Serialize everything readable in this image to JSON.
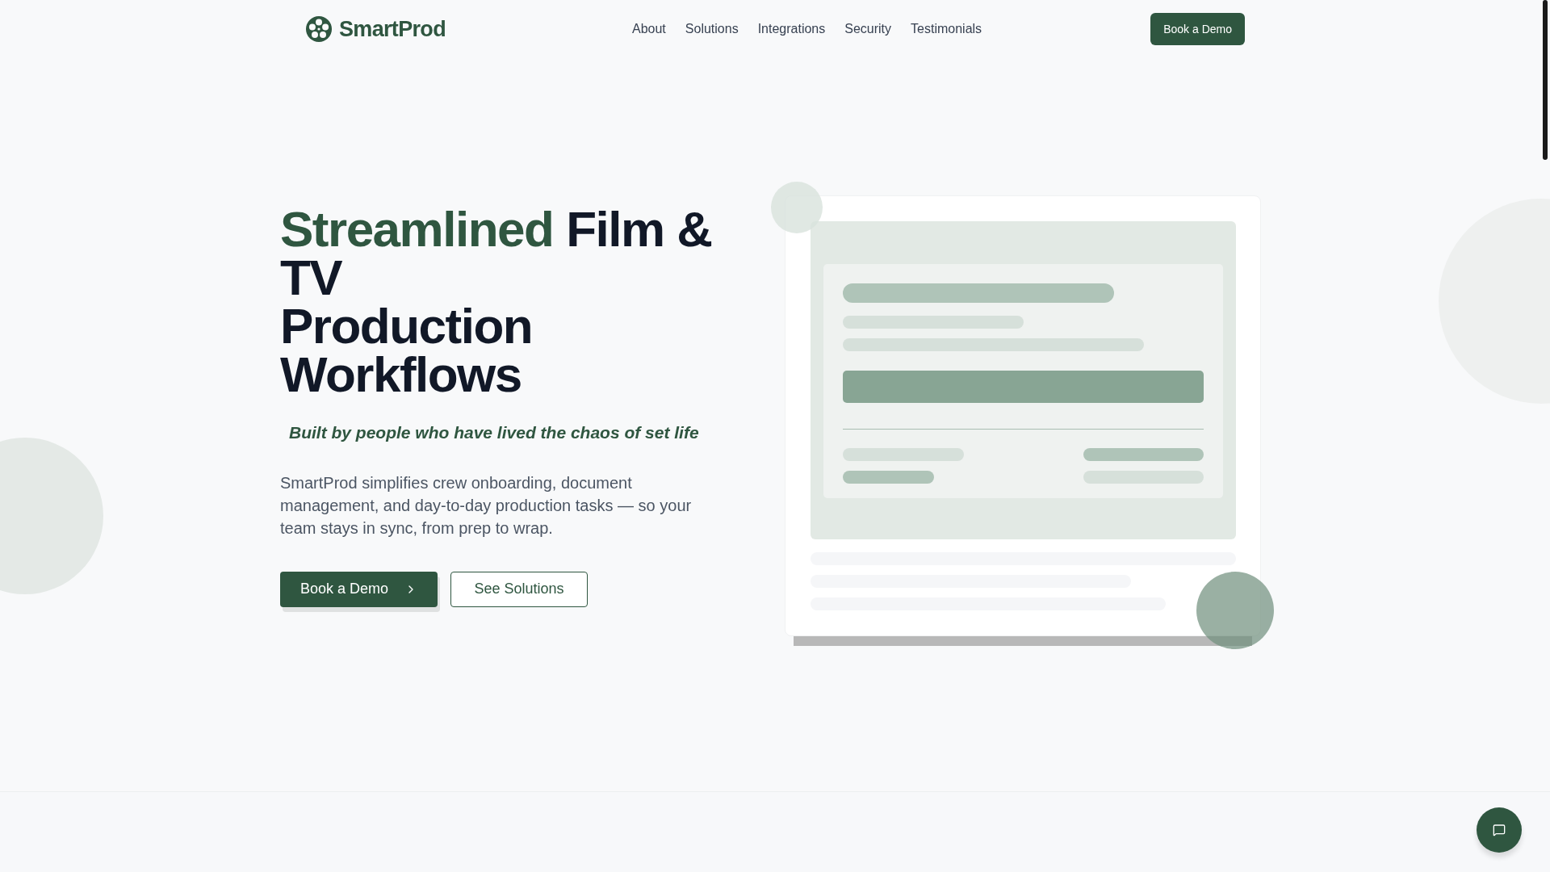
{
  "nav": {
    "logo": "SmartProd",
    "links": [
      "About",
      "Solutions",
      "Integrations",
      "Security",
      "Testimonials"
    ],
    "cta": "Book a Demo"
  },
  "hero": {
    "title_highlight": "Streamlined",
    "title_lines": [
      "Film &",
      "TV",
      "Production",
      "Workflows"
    ],
    "tagline": "Built by people who have lived the chaos of set life",
    "description": "SmartProd simplifies crew onboarding, document management, and day-to-day production tasks — so your team stays in sync, from prep to wrap.",
    "primary_button": "Book a Demo",
    "secondary_button": "See Solutions"
  }
}
